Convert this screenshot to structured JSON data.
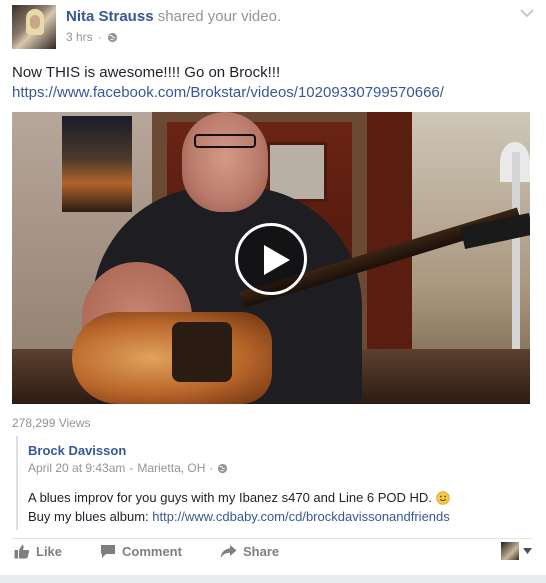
{
  "post": {
    "author": "Nita Strauss",
    "action": "shared your video.",
    "time": "3 hrs",
    "status_text": "Now THIS is awesome!!!! Go on Brock!!!",
    "link": "https://www.facebook.com/Brokstar/videos/10209330799570666/",
    "views": "278,299 Views"
  },
  "shared": {
    "name": "Brock Davisson",
    "date": "April 20 at 9:43am",
    "location": "Marietta, OH",
    "description": "A blues improv for you guys with my Ibanez s470 and Line 6 POD HD.",
    "buy_prefix": "Buy my blues album:",
    "buy_link": "http://www.cdbaby.com/cd/brockdavissonandfriends"
  },
  "actions": {
    "like": "Like",
    "comment": "Comment",
    "share": "Share"
  },
  "icons": {
    "privacy": "globe-icon",
    "menu": "chevron-down-icon",
    "emoji": "smile-icon",
    "like": "thumbs-up-icon",
    "comment": "speech-bubble-icon",
    "share": "share-arrow-icon",
    "play": "play-icon"
  },
  "colors": {
    "link": "#365899",
    "meta": "#90949c",
    "text": "#1d2129"
  }
}
